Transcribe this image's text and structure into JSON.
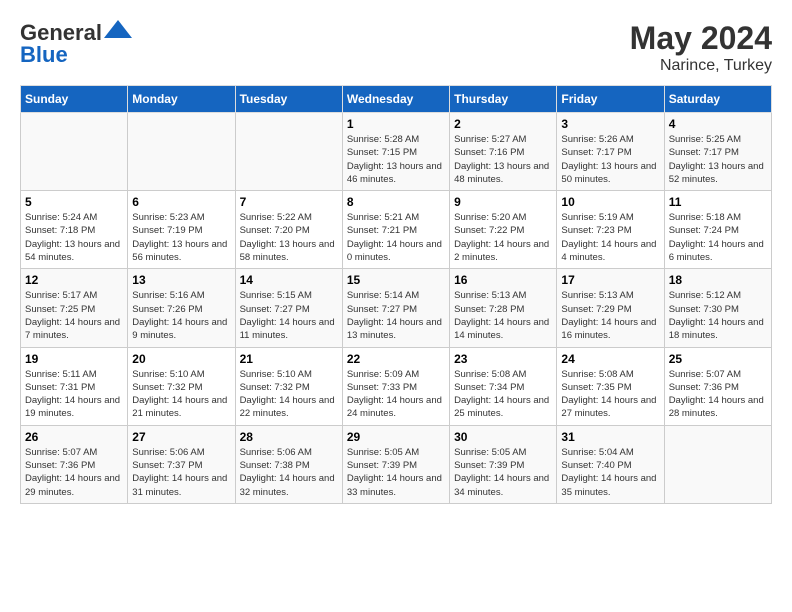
{
  "header": {
    "logo_general": "General",
    "logo_blue": "Blue",
    "title": "May 2024",
    "subtitle": "Narince, Turkey"
  },
  "days_of_week": [
    "Sunday",
    "Monday",
    "Tuesday",
    "Wednesday",
    "Thursday",
    "Friday",
    "Saturday"
  ],
  "weeks": [
    [
      {
        "day": "",
        "content": ""
      },
      {
        "day": "",
        "content": ""
      },
      {
        "day": "",
        "content": ""
      },
      {
        "day": "1",
        "content": "Sunrise: 5:28 AM\nSunset: 7:15 PM\nDaylight: 13 hours and 46 minutes."
      },
      {
        "day": "2",
        "content": "Sunrise: 5:27 AM\nSunset: 7:16 PM\nDaylight: 13 hours and 48 minutes."
      },
      {
        "day": "3",
        "content": "Sunrise: 5:26 AM\nSunset: 7:17 PM\nDaylight: 13 hours and 50 minutes."
      },
      {
        "day": "4",
        "content": "Sunrise: 5:25 AM\nSunset: 7:17 PM\nDaylight: 13 hours and 52 minutes."
      }
    ],
    [
      {
        "day": "5",
        "content": "Sunrise: 5:24 AM\nSunset: 7:18 PM\nDaylight: 13 hours and 54 minutes."
      },
      {
        "day": "6",
        "content": "Sunrise: 5:23 AM\nSunset: 7:19 PM\nDaylight: 13 hours and 56 minutes."
      },
      {
        "day": "7",
        "content": "Sunrise: 5:22 AM\nSunset: 7:20 PM\nDaylight: 13 hours and 58 minutes."
      },
      {
        "day": "8",
        "content": "Sunrise: 5:21 AM\nSunset: 7:21 PM\nDaylight: 14 hours and 0 minutes."
      },
      {
        "day": "9",
        "content": "Sunrise: 5:20 AM\nSunset: 7:22 PM\nDaylight: 14 hours and 2 minutes."
      },
      {
        "day": "10",
        "content": "Sunrise: 5:19 AM\nSunset: 7:23 PM\nDaylight: 14 hours and 4 minutes."
      },
      {
        "day": "11",
        "content": "Sunrise: 5:18 AM\nSunset: 7:24 PM\nDaylight: 14 hours and 6 minutes."
      }
    ],
    [
      {
        "day": "12",
        "content": "Sunrise: 5:17 AM\nSunset: 7:25 PM\nDaylight: 14 hours and 7 minutes."
      },
      {
        "day": "13",
        "content": "Sunrise: 5:16 AM\nSunset: 7:26 PM\nDaylight: 14 hours and 9 minutes."
      },
      {
        "day": "14",
        "content": "Sunrise: 5:15 AM\nSunset: 7:27 PM\nDaylight: 14 hours and 11 minutes."
      },
      {
        "day": "15",
        "content": "Sunrise: 5:14 AM\nSunset: 7:27 PM\nDaylight: 14 hours and 13 minutes."
      },
      {
        "day": "16",
        "content": "Sunrise: 5:13 AM\nSunset: 7:28 PM\nDaylight: 14 hours and 14 minutes."
      },
      {
        "day": "17",
        "content": "Sunrise: 5:13 AM\nSunset: 7:29 PM\nDaylight: 14 hours and 16 minutes."
      },
      {
        "day": "18",
        "content": "Sunrise: 5:12 AM\nSunset: 7:30 PM\nDaylight: 14 hours and 18 minutes."
      }
    ],
    [
      {
        "day": "19",
        "content": "Sunrise: 5:11 AM\nSunset: 7:31 PM\nDaylight: 14 hours and 19 minutes."
      },
      {
        "day": "20",
        "content": "Sunrise: 5:10 AM\nSunset: 7:32 PM\nDaylight: 14 hours and 21 minutes."
      },
      {
        "day": "21",
        "content": "Sunrise: 5:10 AM\nSunset: 7:32 PM\nDaylight: 14 hours and 22 minutes."
      },
      {
        "day": "22",
        "content": "Sunrise: 5:09 AM\nSunset: 7:33 PM\nDaylight: 14 hours and 24 minutes."
      },
      {
        "day": "23",
        "content": "Sunrise: 5:08 AM\nSunset: 7:34 PM\nDaylight: 14 hours and 25 minutes."
      },
      {
        "day": "24",
        "content": "Sunrise: 5:08 AM\nSunset: 7:35 PM\nDaylight: 14 hours and 27 minutes."
      },
      {
        "day": "25",
        "content": "Sunrise: 5:07 AM\nSunset: 7:36 PM\nDaylight: 14 hours and 28 minutes."
      }
    ],
    [
      {
        "day": "26",
        "content": "Sunrise: 5:07 AM\nSunset: 7:36 PM\nDaylight: 14 hours and 29 minutes."
      },
      {
        "day": "27",
        "content": "Sunrise: 5:06 AM\nSunset: 7:37 PM\nDaylight: 14 hours and 31 minutes."
      },
      {
        "day": "28",
        "content": "Sunrise: 5:06 AM\nSunset: 7:38 PM\nDaylight: 14 hours and 32 minutes."
      },
      {
        "day": "29",
        "content": "Sunrise: 5:05 AM\nSunset: 7:39 PM\nDaylight: 14 hours and 33 minutes."
      },
      {
        "day": "30",
        "content": "Sunrise: 5:05 AM\nSunset: 7:39 PM\nDaylight: 14 hours and 34 minutes."
      },
      {
        "day": "31",
        "content": "Sunrise: 5:04 AM\nSunset: 7:40 PM\nDaylight: 14 hours and 35 minutes."
      },
      {
        "day": "",
        "content": ""
      }
    ]
  ]
}
